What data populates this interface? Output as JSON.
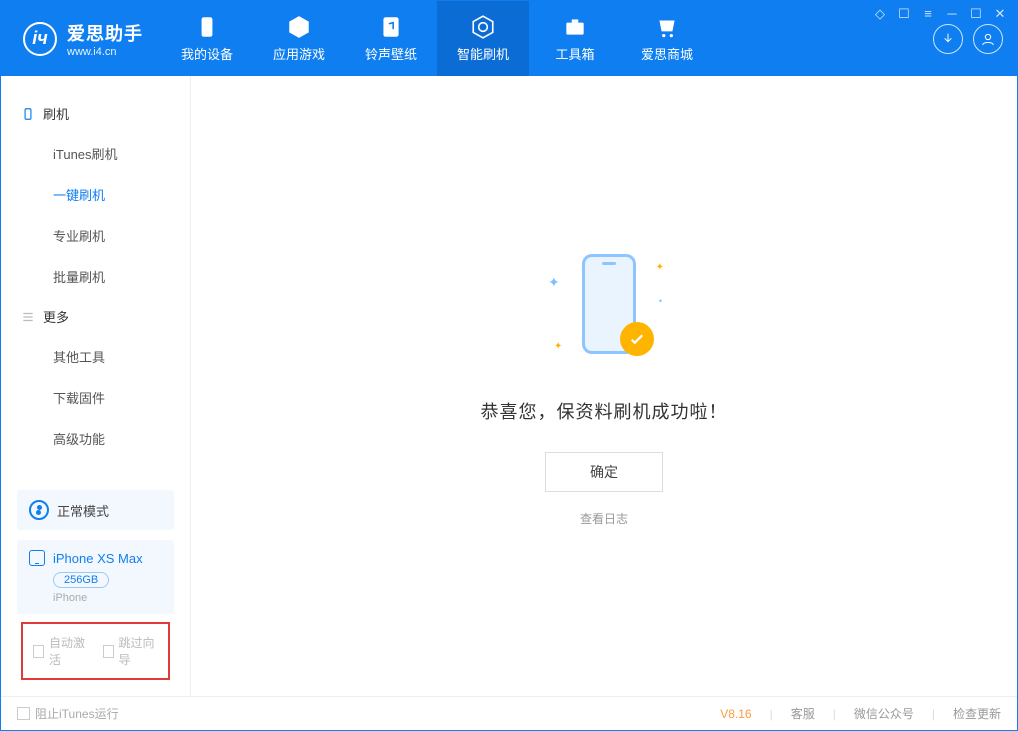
{
  "brand": {
    "name": "爱思助手",
    "url": "www.i4.cn"
  },
  "nav": [
    {
      "label": "我的设备",
      "icon": "device"
    },
    {
      "label": "应用游戏",
      "icon": "cube"
    },
    {
      "label": "铃声壁纸",
      "icon": "music"
    },
    {
      "label": "智能刷机",
      "icon": "refresh",
      "active": true
    },
    {
      "label": "工具箱",
      "icon": "toolbox"
    },
    {
      "label": "爱思商城",
      "icon": "cart"
    }
  ],
  "sidebar": {
    "group1": {
      "title": "刷机",
      "items": [
        "iTunes刷机",
        "一键刷机",
        "专业刷机",
        "批量刷机"
      ],
      "activeIndex": 1
    },
    "group2": {
      "title": "更多",
      "items": [
        "其他工具",
        "下载固件",
        "高级功能"
      ]
    },
    "mode": "正常模式",
    "device": {
      "name": "iPhone XS Max",
      "storage": "256GB",
      "type": "iPhone"
    },
    "checks": {
      "autoActivate": "自动激活",
      "skipGuide": "跳过向导"
    }
  },
  "main": {
    "success": "恭喜您，保资料刷机成功啦！",
    "ok": "确定",
    "viewLog": "查看日志"
  },
  "footer": {
    "blockItunes": "阻止iTunes运行",
    "version": "V8.16",
    "links": [
      "客服",
      "微信公众号",
      "检查更新"
    ]
  }
}
